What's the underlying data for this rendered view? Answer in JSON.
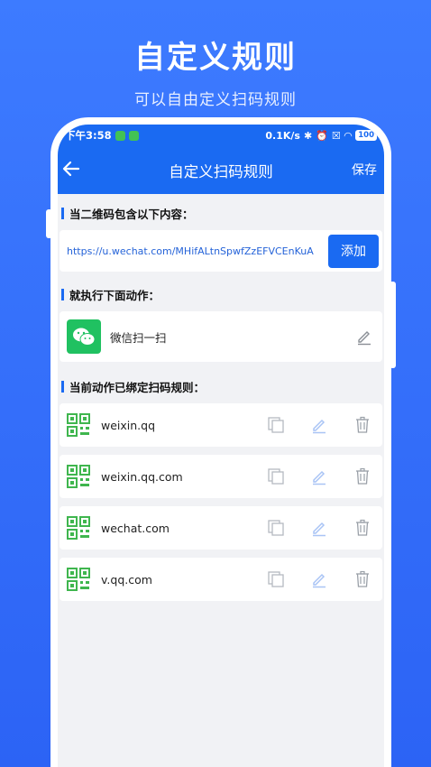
{
  "promo": {
    "title": "自定义规则",
    "subtitle": "可以自由定义扫码规则"
  },
  "status_bar": {
    "time": "下午3:58",
    "network_speed": "0.1K/s",
    "battery": "100"
  },
  "nav": {
    "title": "自定义扫码规则",
    "save_label": "保存"
  },
  "sections": {
    "qr_contains_label": "当二维码包含以下内容：",
    "execute_label": "就执行下面动作：",
    "bound_rules_label": "当前动作已绑定扫码规则："
  },
  "input": {
    "value": "https://u.wechat.com/MHifALtnSpwfZzEFVCEnKuA",
    "add_label": "添加"
  },
  "action": {
    "name": "微信扫一扫"
  },
  "rules": [
    {
      "name": "weixin.qq"
    },
    {
      "name": "weixin.qq.com"
    },
    {
      "name": "wechat.com"
    },
    {
      "name": "v.qq.com"
    }
  ],
  "colors": {
    "primary": "#1a6af2",
    "background": "#3d7bff",
    "wechat_green": "#20c161",
    "qr_green": "#3fb64e",
    "icon_grey": "#9aa0a8",
    "icon_light_blue": "#a9c4f5"
  },
  "icons": {
    "back": "arrow-left-icon",
    "qr": "qr-code-icon",
    "copy": "copy-icon",
    "edit": "pencil-icon",
    "delete": "trash-icon",
    "wechat": "wechat-logo-icon"
  }
}
